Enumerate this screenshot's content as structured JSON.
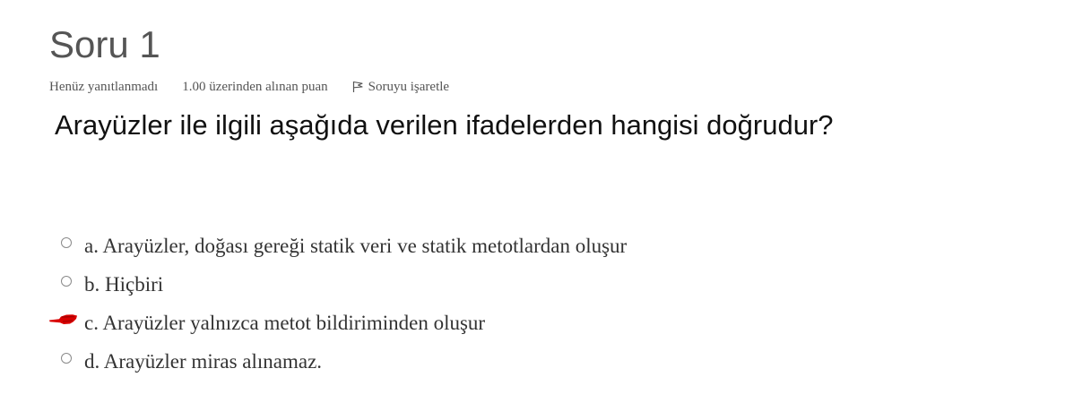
{
  "question": {
    "title": "Soru 1",
    "status": "Henüz yanıtlanmadı",
    "grade": "1.00 üzerinden alınan puan",
    "flag_label": "Soruyu işaretle",
    "text": "Arayüzler ile ilgili aşağıda verilen ifadelerden hangisi doğrudur?"
  },
  "answers": [
    {
      "label": "a. Arayüzler, doğası gereği statik veri ve statik metotlardan oluşur",
      "marked": false
    },
    {
      "label": "b. Hiçbiri",
      "marked": false
    },
    {
      "label": "c. Arayüzler yalnızca metot bildiriminden oluşur",
      "marked": true
    },
    {
      "label": "d. Arayüzler miras alınamaz.",
      "marked": false
    }
  ],
  "colors": {
    "title": "#555555",
    "meta": "#555555",
    "question_text": "#111111",
    "answer_text": "#333333",
    "highlight_mark": "#d90000"
  },
  "icons": {
    "flag": "flag-icon",
    "radio": "radio-button",
    "mark": "red-scribble-mark"
  }
}
